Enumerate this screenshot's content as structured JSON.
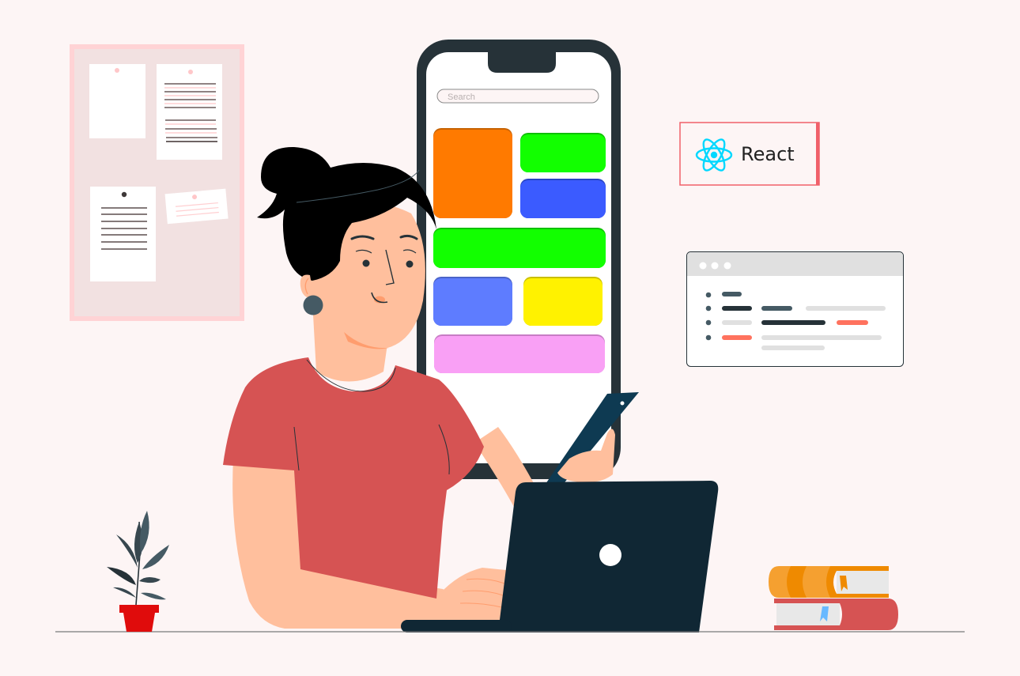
{
  "scene": {
    "background_color": "#fdf5f5",
    "description": "Woman using a smartphone and laptop, with a phone app mockup, React badge and code window"
  },
  "phone_mockup": {
    "search": {
      "placeholder": "Search"
    },
    "tiles": [
      {
        "name": "orange-tile",
        "color": "#ff7a00"
      },
      {
        "name": "green-tile-small",
        "color": "#12ff00"
      },
      {
        "name": "blue-tile",
        "color": "#3b5bff"
      },
      {
        "name": "green-tile-wide",
        "color": "#12ff00"
      },
      {
        "name": "periwinkle-tile",
        "color": "#5e7cff"
      },
      {
        "name": "yellow-tile",
        "color": "#fff200"
      },
      {
        "name": "pink-tile",
        "color": "#f9a0f5"
      }
    ],
    "frame_color": "#263238"
  },
  "react_badge": {
    "label": "React",
    "icon": "react-atom-icon",
    "icon_color": "#00d8ff",
    "border_color": "#f0606a"
  },
  "code_window": {
    "title_bar_color": "#e0e0e0",
    "dots": 3,
    "accent_color": "#ff725e",
    "dark_color": "#263238",
    "muted_color": "#455a64"
  },
  "corkboard": {
    "frame_color": "#ffd3d5",
    "board_color": "#f2e1e1",
    "notes": 4
  },
  "character": {
    "shirt_color": "#d65353",
    "skin_color": "#ffbf9d",
    "hair_color": "#000000"
  },
  "props": {
    "laptop_color": "#102734",
    "handheld_phone_color": "#0e3a52",
    "pot_color": "#e00c0c",
    "books": [
      "orange-book",
      "red-book"
    ]
  }
}
